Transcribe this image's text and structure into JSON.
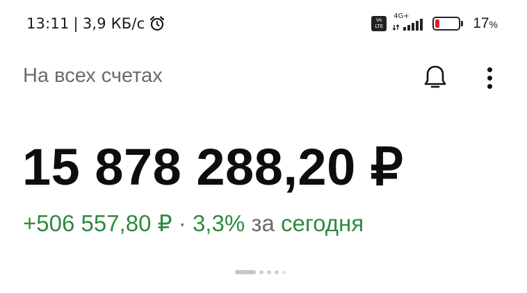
{
  "status_bar": {
    "time": "13:11",
    "separator": "|",
    "net_speed": "3,9 КБ/с",
    "network_type": "4G+",
    "volte_label": "Vo LTE",
    "battery_percent": "17",
    "battery_unit": "%",
    "battery_level": 0.17,
    "battery_color": "#e0202a",
    "alarm_icon": "alarm-clock-icon"
  },
  "header": {
    "title": "На всех счетах",
    "notifications_icon": "bell-icon",
    "menu_icon": "more-vertical-icon"
  },
  "balance": {
    "amount": "15 878 288,20 ₽"
  },
  "change": {
    "amount": "+506 557,80 ₽",
    "separator": "·",
    "percent": "3,3%",
    "period_prefix": "за",
    "period": "сегодня",
    "color": "#2e8b3d"
  },
  "pager": {
    "pages": 5,
    "active_index": 0
  }
}
